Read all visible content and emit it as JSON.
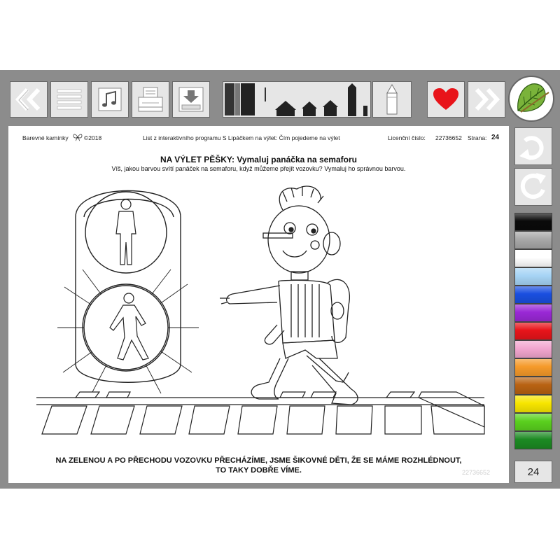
{
  "header": {
    "brand": "Barevné kamínky",
    "copyright": "©2018",
    "program": "List z interaktivního programu S Lipáčkem na výlet: Čím pojedeme na výlet",
    "license_label": "Licenční číslo:",
    "license_number": "22736652",
    "page_label": "Strana:",
    "page_number": "24"
  },
  "worksheet": {
    "title": "NA VÝLET PĚŠKY: Vymaluj panáčka na semaforu",
    "instruction": "Víš, jakou barvou svítí panáček na semaforu, když můžeme přejít vozovku? Vymaluj ho správnou barvou.",
    "verse_line1": "NA ZELENOU A PO PŘECHODU VOZOVKU PŘECHÁZÍME, JSME ŠIKOVNÉ DĚTI, ŽE SE MÁME ROZHLÉDNOUT,",
    "verse_line2": "TO TAKY DOBŘE VÍME.",
    "watermark": "22736652"
  },
  "sidebar": {
    "page_indicator": "24"
  },
  "palette": [
    "#0a0a0a",
    "#a8a8a8",
    "#ffffff",
    "#a6d4f5",
    "#1a4fe0",
    "#9a28d6",
    "#e8141a",
    "#f2a6cf",
    "#f59a2a",
    "#b86212",
    "#f7e600",
    "#5ad01e",
    "#1c8a22"
  ],
  "icons": {
    "back": "double-chevron-left-icon",
    "menu": "menu-lines-icon",
    "music": "music-note-icon",
    "print": "printer-icon",
    "save": "download-icon",
    "favorite": "heart-icon",
    "forward": "double-chevron-right-icon",
    "logo": "linden-leaf-icon",
    "undo": "undo-arrow-icon",
    "reset": "reset-circle-icon"
  },
  "colors": {
    "heart": "#e8141a",
    "toolbar_bg": "#8c8c8c",
    "button_bg": "#e6e6e6"
  }
}
